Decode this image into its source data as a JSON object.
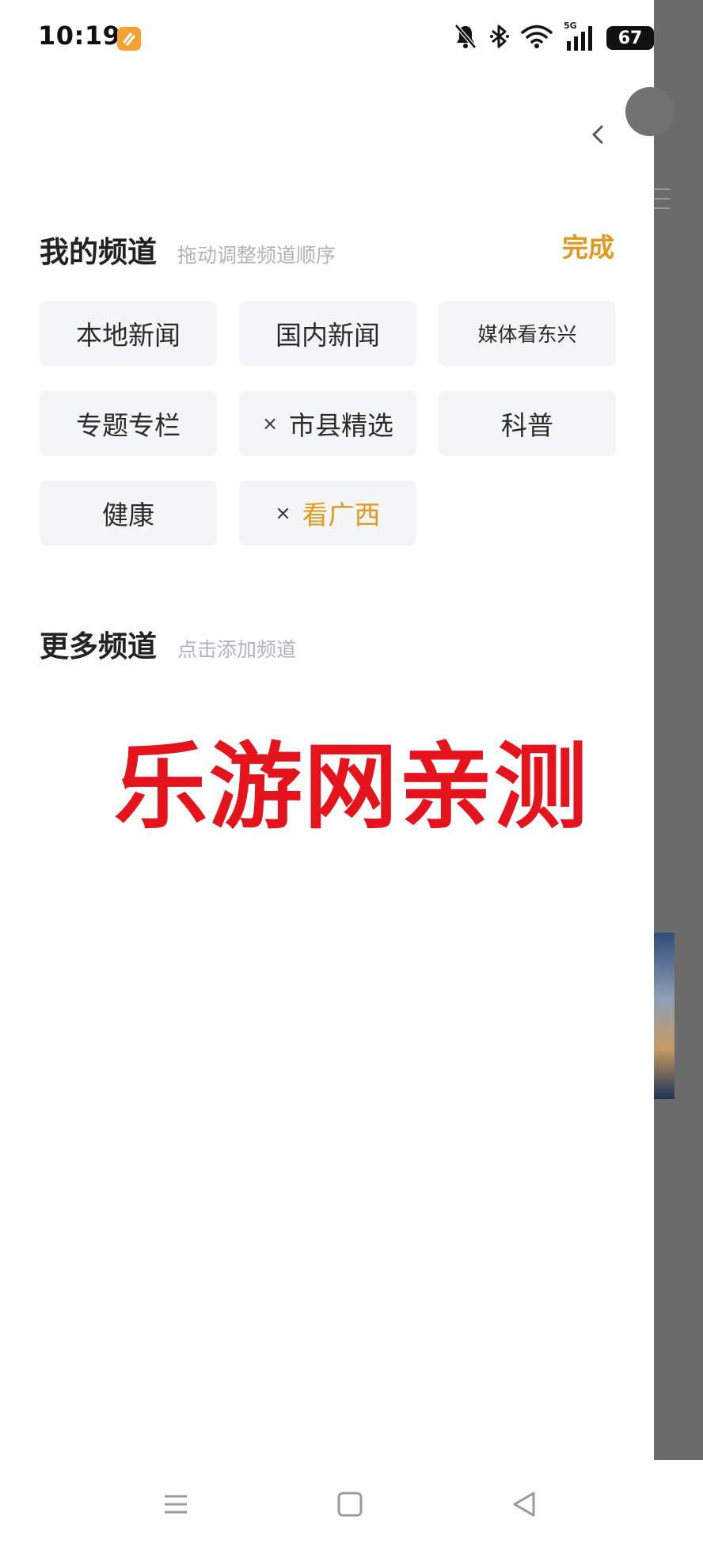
{
  "status_bar": {
    "time": "10:19",
    "network": "5G",
    "battery": "67"
  },
  "my_channels": {
    "title": "我的频道",
    "hint": "拖动调整频道顺序",
    "done_label": "完成",
    "remove_mark": "×",
    "items": [
      {
        "label": "本地新闻"
      },
      {
        "label": "国内新闻"
      },
      {
        "label": "媒体看东兴"
      },
      {
        "label": "专题专栏"
      },
      {
        "label": "市县精选"
      },
      {
        "label": "科普"
      },
      {
        "label": "健康"
      },
      {
        "label": "看广西"
      }
    ]
  },
  "more_channels": {
    "title": "更多频道",
    "hint": "点击添加频道"
  },
  "watermark": "乐游网亲测",
  "colors": {
    "accent": "#e19a1e",
    "watermark": "#e4131c",
    "chip_bg": "#f4f5f7",
    "hint_text": "#b0b3ba",
    "overlay": "#6b6b6b"
  },
  "icons": [
    "app-badge-icon",
    "mute-bell-icon",
    "bluetooth-icon",
    "wifi-icon",
    "signal-icon",
    "battery-icon",
    "chevron-left-icon",
    "menu-icon",
    "home-square-icon",
    "back-triangle-icon"
  ]
}
